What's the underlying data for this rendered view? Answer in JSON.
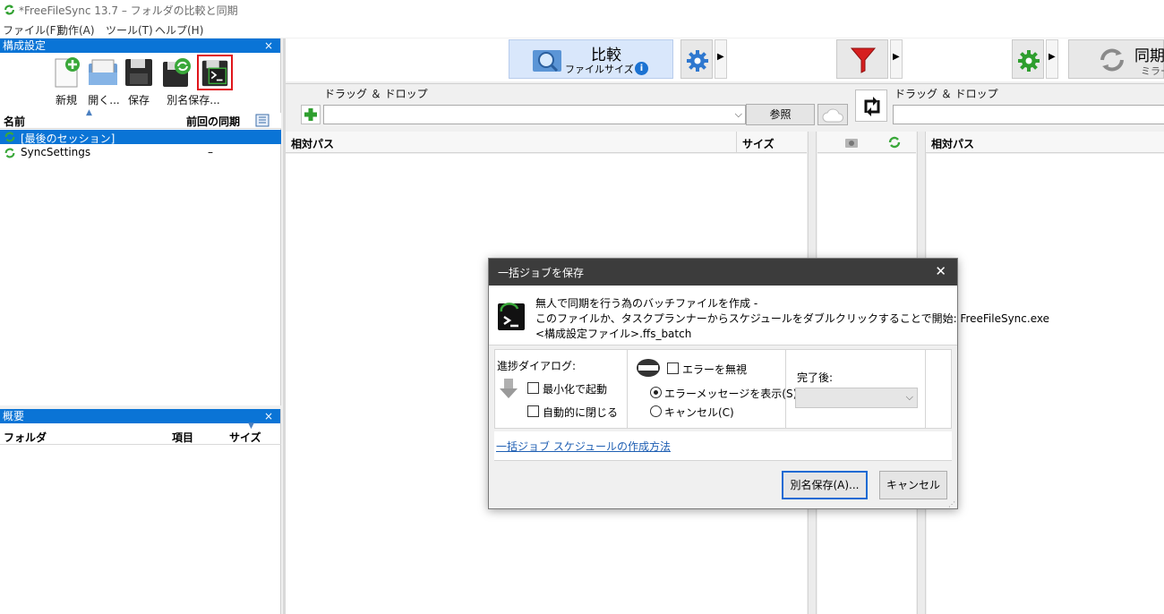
{
  "window": {
    "title": "*FreeFileSync 13.7 – フォルダの比較と同期"
  },
  "menu": [
    "ファイル(F)",
    "動作(A)",
    "ツール(T)",
    "ヘルプ(H)"
  ],
  "config_panel": {
    "title": "構成設定",
    "close": "×",
    "toolbar": [
      "新規",
      "開く...",
      "保存",
      "別名保存..."
    ],
    "columns": {
      "name": "名前",
      "last_sync": "前回の同期"
    },
    "rows": [
      {
        "name": "[最後のセッション]",
        "last_sync": ""
      },
      {
        "name": "SyncSettings",
        "last_sync": "–"
      }
    ]
  },
  "summary_panel": {
    "title": "概要",
    "close": "×",
    "columns": {
      "folder": "フォルダ",
      "items": "項目",
      "size": "サイズ"
    }
  },
  "toolbar": {
    "compare_label": "比較",
    "compare_sub": "ファイルサイズ",
    "sync_label": "同期",
    "sync_sub": "ミラー"
  },
  "left_folder": {
    "drag_drop": "ドラッグ ＆ ドロップ",
    "browse": "参照",
    "path_value": ""
  },
  "right_folder": {
    "drag_drop": "ドラッグ ＆ ドロップ",
    "path_value": ""
  },
  "grid": {
    "left_col_path": "相対パス",
    "left_col_size": "サイズ",
    "right_col_path": "相対パス"
  },
  "dialog": {
    "title": "一括ジョブを保存",
    "close": "✕",
    "info_line1": "無人で同期を行う為のバッチファイルを作成 -",
    "info_line2": "このファイルか、タスクプランナーからスケジュールをダブルクリックすることで開始: FreeFileSync.exe",
    "info_line3": "<構成設定ファイル>.ffs_batch",
    "progress_label": "進捗ダイアログ:",
    "start_minimized": "最小化で起動",
    "auto_close": "自動的に閉じる",
    "ignore_errors": "エラーを無視",
    "show_error_msg": "エラーメッセージを表示(S)",
    "cancel_opt": "キャンセル(C)",
    "after_label": "完了後:",
    "after_value": "",
    "schedule_link": "一括ジョブ スケジュールの作成方法",
    "save_as_button": "別名保存(A)...",
    "cancel_button": "キャンセル"
  },
  "colors": {
    "accent": "#0a74d6",
    "highlight_border": "#e0151b",
    "dialog_title_bg": "#3c3c3c"
  }
}
